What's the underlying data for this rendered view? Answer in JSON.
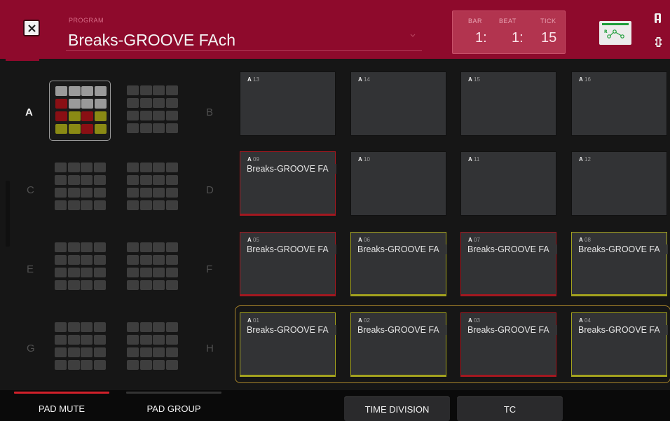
{
  "header": {
    "program_label": "PROGRAM",
    "program_name": "Breaks-GROOVE FAch",
    "counter": {
      "bar_label": "BAR",
      "beat_label": "BEAT",
      "tick_label": "TICK",
      "bar": "1:",
      "beat": "1:",
      "tick": "15"
    },
    "icons": {
      "close": "close-icon",
      "dropdown": "chevron-down-icon",
      "link": "midi-link-icon",
      "alert": "alert-icon",
      "battery": "battery-icon"
    }
  },
  "banks": [
    {
      "letter": "A",
      "active": true
    },
    {
      "letter": "B",
      "active": false
    },
    {
      "letter": "C",
      "active": false
    },
    {
      "letter": "D",
      "active": false
    },
    {
      "letter": "E",
      "active": false
    },
    {
      "letter": "F",
      "active": false
    },
    {
      "letter": "G",
      "active": false
    },
    {
      "letter": "H",
      "active": false
    }
  ],
  "bank_a_preview_colors": [
    "gray",
    "gray",
    "gray",
    "gray",
    "red",
    "gray",
    "gray",
    "gray",
    "red",
    "yellow",
    "red",
    "yellow",
    "yellow",
    "yellow",
    "red",
    "yellow"
  ],
  "pads": [
    {
      "bank": "A",
      "number": "13",
      "name": "",
      "state": "none"
    },
    {
      "bank": "A",
      "number": "14",
      "name": "",
      "state": "none"
    },
    {
      "bank": "A",
      "number": "15",
      "name": "",
      "state": "none"
    },
    {
      "bank": "A",
      "number": "16",
      "name": "",
      "state": "none"
    },
    {
      "bank": "A",
      "number": "09",
      "name": "Breaks-GROOVE FA",
      "state": "red"
    },
    {
      "bank": "A",
      "number": "10",
      "name": "",
      "state": "none"
    },
    {
      "bank": "A",
      "number": "11",
      "name": "",
      "state": "none"
    },
    {
      "bank": "A",
      "number": "12",
      "name": "",
      "state": "none"
    },
    {
      "bank": "A",
      "number": "05",
      "name": "Breaks-GROOVE FA",
      "state": "red"
    },
    {
      "bank": "A",
      "number": "06",
      "name": "Breaks-GROOVE FA",
      "state": "yellow"
    },
    {
      "bank": "A",
      "number": "07",
      "name": "Breaks-GROOVE FA",
      "state": "red"
    },
    {
      "bank": "A",
      "number": "08",
      "name": "Breaks-GROOVE FA",
      "state": "yellow"
    },
    {
      "bank": "A",
      "number": "01",
      "name": "Breaks-GROOVE FA",
      "state": "yellow"
    },
    {
      "bank": "A",
      "number": "02",
      "name": "Breaks-GROOVE FA",
      "state": "yellow"
    },
    {
      "bank": "A",
      "number": "03",
      "name": "Breaks-GROOVE FA",
      "state": "red"
    },
    {
      "bank": "A",
      "number": "04",
      "name": "Breaks-GROOVE FA",
      "state": "yellow"
    }
  ],
  "bottom": {
    "pad_mute": "PAD MUTE",
    "pad_group": "PAD GROUP",
    "time_division": "TIME DIVISION",
    "tc": "TC"
  },
  "colors": {
    "header_bg": "#8e0a2c",
    "counter_bg": "#b2344f",
    "mute_red": "#a31820",
    "group_yellow": "#a3a21e",
    "mini_gray": "#9a9a9a",
    "mini_red": "#8a0f14",
    "mini_yellow": "#8a8a14",
    "outline_orange": "#a8842a"
  }
}
